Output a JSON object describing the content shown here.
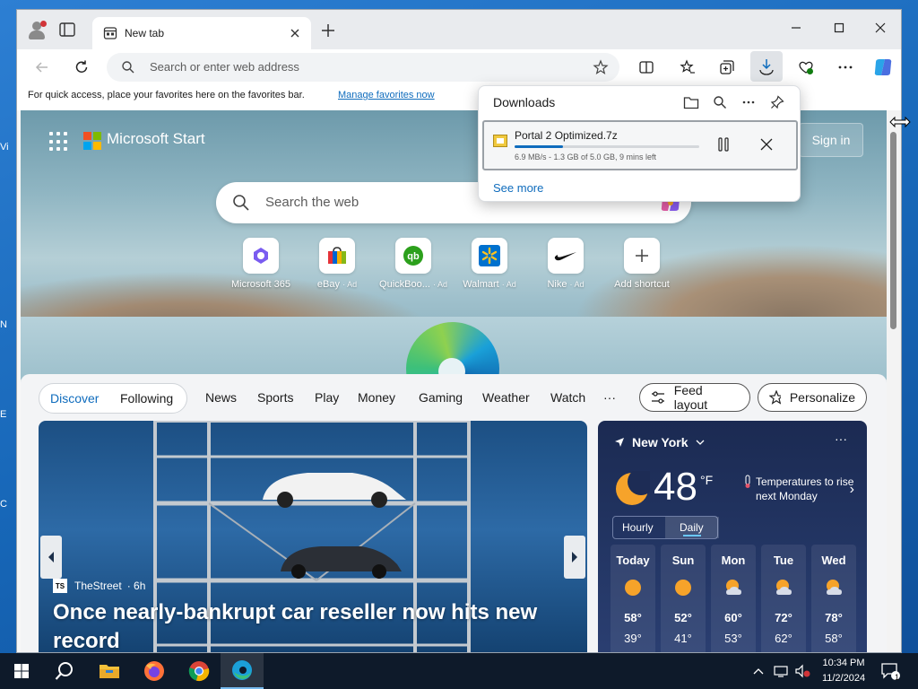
{
  "browser": {
    "tab_title": "New tab",
    "address_placeholder": "Search or enter web address",
    "favorites_message": "For quick access, place your favorites here on the favorites bar.",
    "favorites_link": "Manage favorites now"
  },
  "downloads": {
    "title": "Downloads",
    "item": {
      "filename": "Portal 2 Optimized.7z",
      "status": "6.9 MB/s - 1.3 GB of 5.0 GB, 9 mins left",
      "progress": 0.26
    },
    "see_more": "See more"
  },
  "start": {
    "brand": "Microsoft Start",
    "signin": "Sign in",
    "search_placeholder": "Search the web",
    "shortcuts": [
      {
        "label": "Microsoft 365",
        "ad": ""
      },
      {
        "label": "eBay",
        "ad": "· Ad"
      },
      {
        "label": "QuickBoo...",
        "ad": "· Ad"
      },
      {
        "label": "Walmart",
        "ad": "· Ad"
      },
      {
        "label": "Nike",
        "ad": "· Ad"
      },
      {
        "label": "Add shortcut",
        "ad": ""
      }
    ]
  },
  "feed": {
    "discover": "Discover",
    "following": "Following",
    "tabs": [
      "News",
      "Sports",
      "Play",
      "Money",
      "Gaming",
      "Weather",
      "Watch"
    ],
    "more": "···",
    "feed_layout": "Feed layout",
    "personalize": "Personalize"
  },
  "article": {
    "source": "TheStreet",
    "source_logo": "TS",
    "age": "· 6h",
    "headline": "Once nearly-bankrupt car reseller now hits new record"
  },
  "weather": {
    "location": "New York",
    "more": "···",
    "temp": "48",
    "unit": "°F",
    "alert": "Temperatures to rise next Monday",
    "hourly": "Hourly",
    "daily": "Daily",
    "days": [
      {
        "name": "Today",
        "hi": "58°",
        "lo": "39°",
        "icon": "sun-icon"
      },
      {
        "name": "Sun",
        "hi": "52°",
        "lo": "41°",
        "icon": "sun-icon"
      },
      {
        "name": "Mon",
        "hi": "60°",
        "lo": "53°",
        "icon": "partly-cloudy-icon"
      },
      {
        "name": "Tue",
        "hi": "72°",
        "lo": "62°",
        "icon": "partly-cloudy-icon"
      },
      {
        "name": "Wed",
        "hi": "78°",
        "lo": "58°",
        "icon": "partly-cloudy-icon"
      }
    ]
  },
  "taskbar": {
    "time": "10:34 PM",
    "date": "11/2/2024",
    "notification_count": "1"
  },
  "colors": {
    "accent": "#0f6cbd",
    "taskbar": "#0e1a2a",
    "weather_bg": "#1b2a52"
  }
}
